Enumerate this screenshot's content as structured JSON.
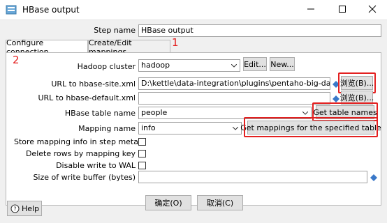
{
  "window": {
    "title": "HBase output"
  },
  "step_name": {
    "label": "Step name",
    "value": "HBase output"
  },
  "tabs": [
    {
      "label": "Configure connection"
    },
    {
      "label": "Create/Edit mappings"
    }
  ],
  "form": {
    "hadoop_cluster": {
      "label": "Hadoop cluster",
      "value": "hadoop",
      "edit_label": "Edit...",
      "new_label": "New..."
    },
    "hbase_site": {
      "label": "URL to hbase-site.xml",
      "value": "D:\\kettle\\data-integration\\plugins\\pentaho-big-data-plug",
      "browse_label": "浏览(B)..."
    },
    "hbase_default": {
      "label": "URL to hbase-default.xml",
      "value": "",
      "browse_label": "浏览(B)..."
    },
    "table_name": {
      "label": "HBase table name",
      "value": "people",
      "button_label": "Get table names"
    },
    "mapping_name": {
      "label": "Mapping name",
      "value": "info",
      "button_label": "Get mappings for the specified table"
    },
    "store_mapping": {
      "label": "Store mapping info in step meta",
      "checked": false
    },
    "delete_rows": {
      "label": "Delete rows by mapping key",
      "checked": false
    },
    "disable_wal": {
      "label": "Disable write to WAL",
      "checked": false
    },
    "write_buffer": {
      "label": "Size of write buffer (bytes)",
      "value": ""
    }
  },
  "footer": {
    "ok_label": "确定(O)",
    "cancel_label": "取消(C)",
    "help_label": "Help"
  },
  "annotations": {
    "marker_1": "1",
    "marker_2": "2",
    "color": "#e32020"
  },
  "icons": {
    "app": "hbase-output-icon",
    "minimize": "minimize-icon",
    "maximize": "maximize-icon",
    "close": "close-icon",
    "variable": "variable-diamond-icon",
    "help": "help-icon"
  }
}
